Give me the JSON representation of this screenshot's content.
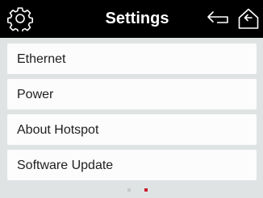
{
  "header": {
    "title": "Settings",
    "icons": [
      "gear-icon",
      "back-arrow-icon",
      "home-icon"
    ]
  },
  "menu": {
    "items": [
      {
        "label": "Ethernet"
      },
      {
        "label": "Power"
      },
      {
        "label": "About Hotspot"
      },
      {
        "label": "Software Update"
      }
    ]
  },
  "pagination": {
    "pages": 2,
    "current": 2
  },
  "colors": {
    "header_bg": "#000000",
    "page_bg": "#dfe3e4",
    "item_bg": "#fcfcfc",
    "active_dot": "#c81e2d",
    "inactive_dot": "#c5c9cb"
  }
}
